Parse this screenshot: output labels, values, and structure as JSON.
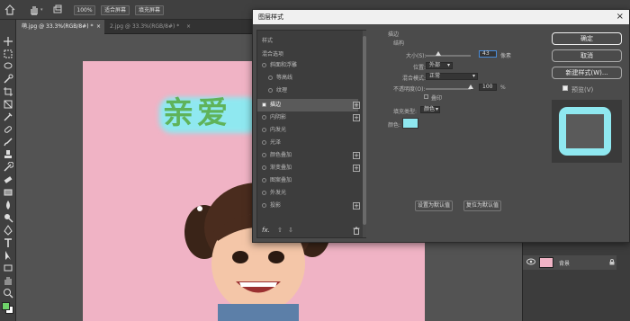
{
  "optbar": {
    "zoom_label": "100%",
    "fit_screen_label": "适合屏幕",
    "fill_screen_label": "填充屏幕"
  },
  "tabs": [
    {
      "label": "萌.jpg @ 33.3%(RGB/8#) *",
      "close": "×"
    },
    {
      "label": "2.jpg @ 33.3%(RGB/8#) *",
      "close": "×"
    }
  ],
  "dialog": {
    "title": "图层样式",
    "close": "×",
    "style_header": "样式",
    "blend_options": "混合选项",
    "items": [
      {
        "label": "斜面和浮雕",
        "plus": false
      },
      {
        "label": "等高线",
        "plus": false
      },
      {
        "label": "纹理",
        "plus": false
      },
      {
        "label": "描边",
        "plus": true,
        "selected": true,
        "checked": "✓"
      },
      {
        "label": "内阴影",
        "plus": true
      },
      {
        "label": "内发光",
        "plus": false
      },
      {
        "label": "光泽",
        "plus": false
      },
      {
        "label": "颜色叠加",
        "plus": true
      },
      {
        "label": "渐变叠加",
        "plus": true
      },
      {
        "label": "图案叠加",
        "plus": false
      },
      {
        "label": "外发光",
        "plus": false
      },
      {
        "label": "投影",
        "plus": true
      }
    ],
    "footer_fx": "fx.",
    "stroke": {
      "section": "描边",
      "structure": "结构",
      "size_label": "大小(S):",
      "size_value": "43",
      "size_unit": "像素",
      "position_label": "位置:",
      "position_value": "外部",
      "blend_label": "混合模式:",
      "blend_value": "正常",
      "opacity_label": "不透明度(O):",
      "opacity_value": "100",
      "opacity_unit": "%",
      "overprint_label": "叠印",
      "fill_type_label": "填充类型:",
      "fill_type_value": "颜色",
      "color_label": "颜色:",
      "stroke_color": "#8fe8f0",
      "set_default": "设置为默认值",
      "reset_default": "复位为默认值"
    },
    "buttons": {
      "ok": "确定",
      "cancel": "取消",
      "new_style": "新建样式(W)...",
      "preview": "预览(V)"
    }
  },
  "layers": {
    "layer_name": "背景"
  },
  "canvas": {
    "text": "亲爱",
    "text_colors": [
      "#5fb35a",
      "#e4507a"
    ],
    "glow_color": "#8fe8f0",
    "background_color": "#f0b3c5"
  },
  "colors": {
    "foreground": "#6fd36a",
    "background": "#ffffff"
  }
}
